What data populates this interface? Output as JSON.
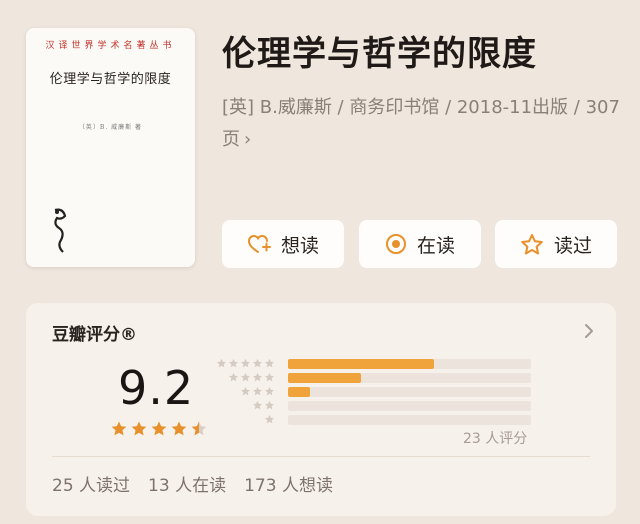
{
  "book": {
    "title": "伦理学与哲学的限度",
    "meta": "[英] B.威廉斯 / 商务印书馆 / 2018-11出版 / 307页",
    "meta_chevron": "›",
    "cover": {
      "series": "汉译世界学术名著丛书",
      "title": "伦理学与哲学的限度",
      "author": "〔英〕B. 威廉斯 著"
    }
  },
  "actions": [
    {
      "label": "想读",
      "icon": "heart-plus-icon"
    },
    {
      "label": "在读",
      "icon": "target-icon"
    },
    {
      "label": "读过",
      "icon": "star-outline-icon"
    }
  ],
  "rating": {
    "title": "豆瓣评分®",
    "score": "9.2",
    "stars": 4.5,
    "distribution": [
      {
        "stars": 5,
        "fraction": 0.6
      },
      {
        "stars": 4,
        "fraction": 0.3
      },
      {
        "stars": 3,
        "fraction": 0.09
      },
      {
        "stars": 2,
        "fraction": 0
      },
      {
        "stars": 1,
        "fraction": 0
      }
    ],
    "total": "23 人评分",
    "stats": [
      "25 人读过",
      "13 人在读",
      "173 人想读"
    ]
  },
  "colors": {
    "accent": "#e8902a",
    "bar": "#f0a33a",
    "track": "#ece4dc",
    "page": "#efe6dd"
  }
}
